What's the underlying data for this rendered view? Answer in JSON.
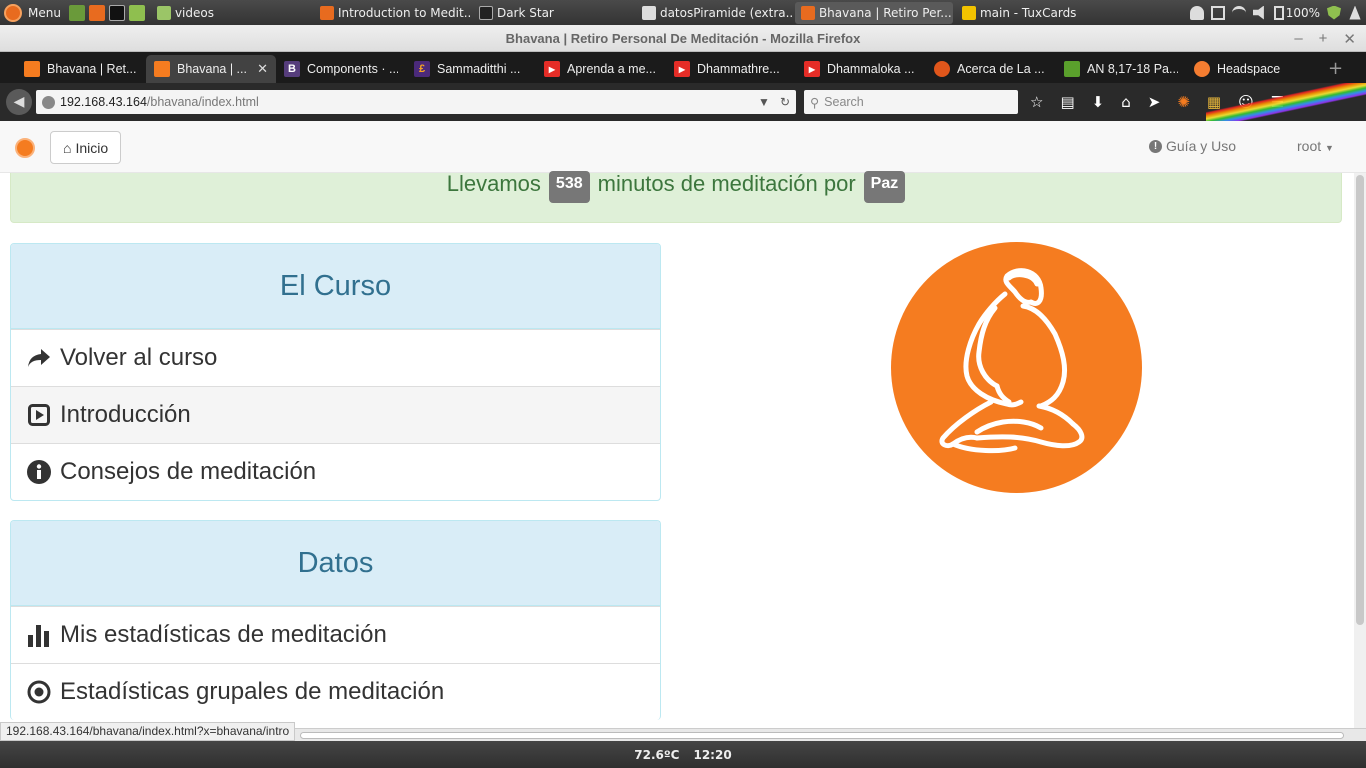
{
  "os": {
    "menu_label": "Menu",
    "taskbar": [
      {
        "label": "videos",
        "color": "#9bc567"
      },
      {
        "label": "Introduction to Medit...",
        "color": "#e86b1f"
      },
      {
        "label": "Dark Star",
        "color": "#222222"
      },
      {
        "label": "datosPiramide (extra...",
        "color": "#dddddd"
      },
      {
        "label": "Bhavana | Retiro Per...",
        "color": "#e86b1f"
      },
      {
        "label": "main - TuxCards",
        "color": "#f2c300"
      }
    ],
    "battery": "100%",
    "temperature": "72.6ºC",
    "time": "12:20"
  },
  "window": {
    "title": "Bhavana | Retiro Personal De Meditación - Mozilla Firefox"
  },
  "tabs": [
    {
      "label": "Bhavana | Ret...",
      "icon_color": "#f57c20",
      "icon_text": ""
    },
    {
      "label": "Bhavana | ...",
      "icon_color": "#f57c20",
      "icon_text": "",
      "active": true
    },
    {
      "label": "Components · ...",
      "icon_color": "#563d7c",
      "icon_text": "B"
    },
    {
      "label": "Sammaditthi ...",
      "icon_color": "#4b2a7a",
      "icon_text": "£"
    },
    {
      "label": "Aprenda a me...",
      "icon_color": "#e52d27",
      "icon_text": "▶"
    },
    {
      "label": "Dhammathre...",
      "icon_color": "#e52d27",
      "icon_text": "▶"
    },
    {
      "label": "Dhammaloka ...",
      "icon_color": "#e52d27",
      "icon_text": "▶"
    },
    {
      "label": "Acerca de La ...",
      "icon_color": "#e0561b",
      "icon_text": ""
    },
    {
      "label": "AN 8,17-18 Pa...",
      "icon_color": "#5aa02c",
      "icon_text": ""
    },
    {
      "label": "Headspace",
      "icon_color": "#f47d31",
      "icon_text": ""
    }
  ],
  "nav": {
    "url_host": "192.168.43.164",
    "url_path": "/bhavana/index.html",
    "search_placeholder": "Search"
  },
  "site": {
    "home_label": "Inicio",
    "guide_label": "Guía y Uso",
    "user_label": "root"
  },
  "alert": {
    "prefix": "Llevamos",
    "minutes": "538",
    "middle": "minutos de meditación por",
    "cause": "Paz"
  },
  "course_panel": {
    "title": "El Curso",
    "items": [
      {
        "label": "Volver al curso",
        "icon": "share-arrow-icon"
      },
      {
        "label": "Introducción",
        "icon": "play-icon"
      },
      {
        "label": "Consejos de meditación",
        "icon": "info-icon"
      }
    ]
  },
  "data_panel": {
    "title": "Datos",
    "items": [
      {
        "label": "Mis estadísticas de meditación",
        "icon": "bar-chart-icon"
      },
      {
        "label": "Estadísticas grupales de meditación",
        "icon": "target-icon"
      }
    ]
  },
  "status_url": "192.168.43.164/bhavana/index.html?x=bhavana/intro",
  "colors": {
    "brand_orange": "#f57c20",
    "alert_bg": "#dff0d8",
    "alert_text": "#3c763d",
    "panel_heading_bg": "#d9edf7",
    "panel_heading_text": "#31708f"
  }
}
